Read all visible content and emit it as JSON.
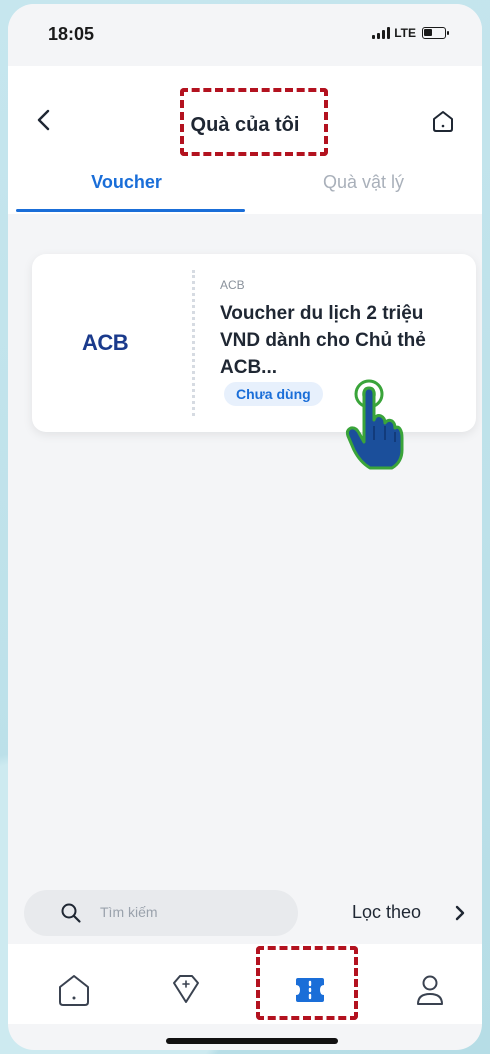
{
  "status_bar": {
    "time": "18:05",
    "network": "LTE"
  },
  "header": {
    "title": "Quà của tôi"
  },
  "tabs": [
    {
      "label": "Voucher",
      "active": true
    },
    {
      "label": "Quà vật lý",
      "active": false
    }
  ],
  "voucher_card": {
    "logo": "ACB",
    "brand": "ACB",
    "title": "Voucher du lịch 2 triệu VND dành cho Chủ thẻ ACB...",
    "status": "Chưa dùng"
  },
  "search": {
    "placeholder": "Tìm kiếm"
  },
  "filter": {
    "label": "Lọc theo"
  },
  "bottom_nav": {
    "items": [
      "home-icon",
      "gift-icon",
      "voucher-icon",
      "profile-icon"
    ],
    "active": "voucher-icon"
  },
  "colors": {
    "accent": "#1a6ed8",
    "highlight": "#b3121f",
    "hand": "#1b4f9b",
    "hand_outline": "#3aa43a"
  }
}
